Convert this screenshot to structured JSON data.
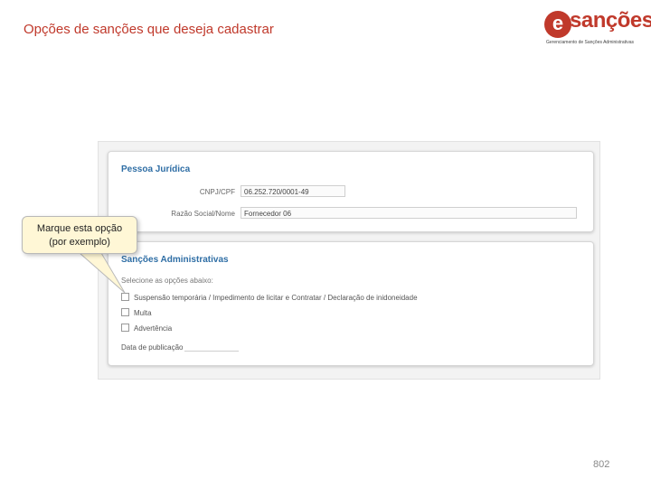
{
  "slide": {
    "title": "Opções de sanções que deseja cadastrar",
    "page_number": "802"
  },
  "logo": {
    "mark": "e",
    "word": "sanções",
    "tagline": "Gerenciamento de Sanções Administrativas"
  },
  "pessoa_juridica": {
    "title": "Pessoa Jurídica",
    "cnpj_label": "CNPJ/CPF",
    "cnpj_value": "06.252.720/0001-49",
    "razao_label": "Razão Social/Nome",
    "razao_value": "Fornecedor 06"
  },
  "sancoes": {
    "title": "Sanções Administrativas",
    "subtitle": "Selecione as opções abaixo:",
    "options": [
      "Suspensão temporária / Impedimento de licitar e Contratar / Declaração de inidoneidade",
      "Multa",
      "Advertência"
    ],
    "publication_label": "Data de publicação"
  },
  "callout": {
    "line1": "Marque esta opção",
    "line2": "(por exemplo)"
  },
  "colors": {
    "title_red": "#c0392b",
    "panel_title_blue": "#2f6ea5",
    "callout_fill": "#fff7d6"
  }
}
